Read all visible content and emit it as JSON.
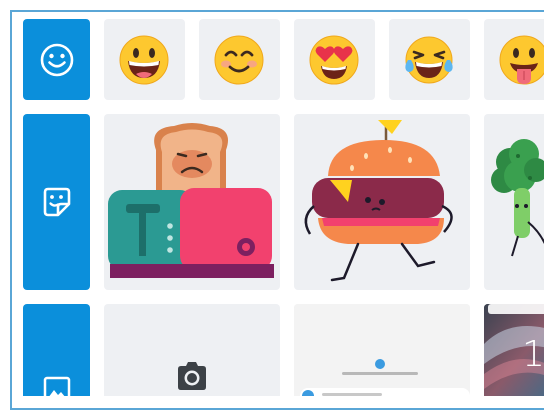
{
  "categories": [
    {
      "id": "emoji",
      "icon": "smiley-icon"
    },
    {
      "id": "stickers",
      "icon": "sticker-icon"
    },
    {
      "id": "photos",
      "icon": "image-icon"
    }
  ],
  "emojis": [
    {
      "icon": "grinning-face-icon"
    },
    {
      "icon": "smiling-face-with-blush-icon"
    },
    {
      "icon": "heart-eyes-face-icon"
    },
    {
      "icon": "tears-of-joy-face-icon"
    },
    {
      "icon": "tongue-out-face-icon"
    }
  ],
  "stickers": [
    {
      "icon": "toaster-sticker"
    },
    {
      "icon": "burger-sticker"
    },
    {
      "icon": "broccoli-sticker"
    }
  ],
  "photos": {
    "camera": {
      "icon": "camera-icon"
    },
    "screenshot": {
      "icon": "screenshot-thumbnail"
    },
    "wallpaper": {
      "icon": "wallpaper-thumbnail",
      "overlay": "1"
    }
  },
  "colors": {
    "accent": "#0b8fdb",
    "tile": "#eef0f3",
    "frame_border": "#5aa6d6"
  }
}
